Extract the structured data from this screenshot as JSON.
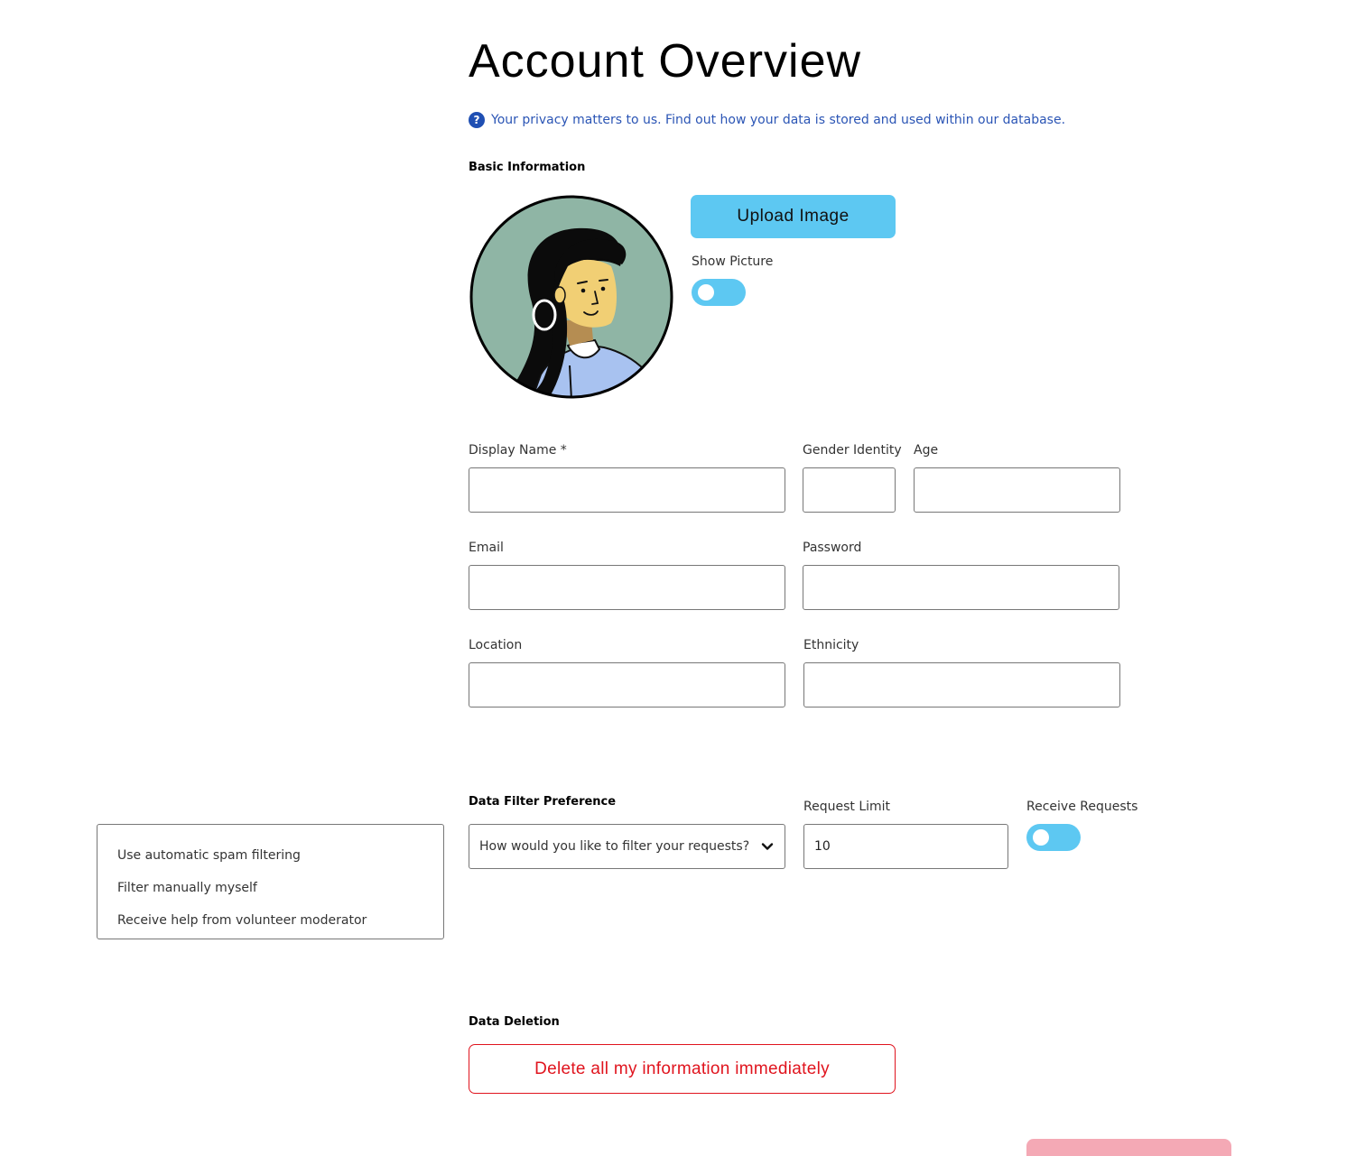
{
  "page": {
    "title": "Account Overview",
    "privacy_note": "Your privacy matters to us. Find out how your data is stored and used within our database.",
    "help_icon_glyph": "?"
  },
  "basic_info": {
    "heading": "Basic Information",
    "upload_label": "Upload Image",
    "show_picture_label": "Show Picture",
    "show_picture_on": false
  },
  "fields": {
    "display_name": {
      "label": "Display Name *",
      "value": ""
    },
    "gender_identity": {
      "label": "Gender Identity",
      "value": ""
    },
    "age": {
      "label": "Age",
      "value": ""
    },
    "email": {
      "label": "Email",
      "value": ""
    },
    "password": {
      "label": "Password",
      "value": ""
    },
    "location": {
      "label": "Location",
      "value": ""
    },
    "ethnicity": {
      "label": "Ethnicity",
      "value": ""
    }
  },
  "data_filter": {
    "heading": "Data Filter Preference",
    "select_placeholder": "How would you like to filter your requests?",
    "options": [
      "Use automatic spam filtering",
      "Filter manually myself",
      "Receive help from volunteer moderator"
    ],
    "request_limit_label": "Request Limit",
    "request_limit_value": "10",
    "receive_requests_label": "Receive Requests",
    "receive_requests_on": false
  },
  "data_deletion": {
    "heading": "Data Deletion",
    "delete_label": "Delete all my information immediately"
  },
  "colors": {
    "accent": "#5dc8f2",
    "danger": "#e0141e",
    "link": "#2b55b5",
    "save_button": "#f4a9b5"
  },
  "icons": {
    "help": "help-circle-icon",
    "chevron": "chevron-down-icon"
  }
}
